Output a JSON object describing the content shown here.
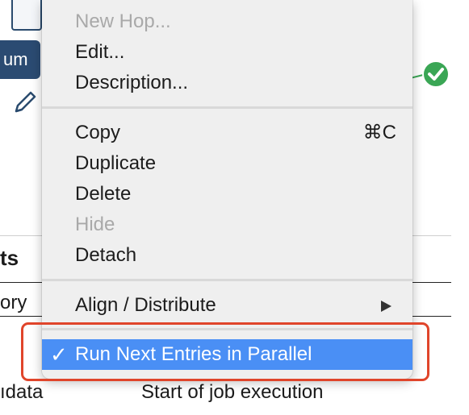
{
  "background": {
    "node_label": "um",
    "section_title": "ts",
    "table_cell_partial": "ory",
    "row_left": "ıdata",
    "row_right": "Start of job execution",
    "icons": [
      "document-icon",
      "pencil-icon",
      "success-check-icon"
    ]
  },
  "context_menu": {
    "items": [
      {
        "label": "New Hop...",
        "enabled": false
      },
      {
        "label": "Edit...",
        "enabled": true
      },
      {
        "label": "Description...",
        "enabled": true
      },
      {
        "label": "Copy",
        "shortcut": "⌘C",
        "enabled": true
      },
      {
        "label": "Duplicate",
        "enabled": true
      },
      {
        "label": "Delete",
        "enabled": true
      },
      {
        "label": "Hide",
        "enabled": false
      },
      {
        "label": "Detach",
        "enabled": true
      },
      {
        "label": "Align / Distribute",
        "enabled": true,
        "submenu": true
      },
      {
        "label": "Run Next Entries in Parallel",
        "checked": true,
        "highlighted": true,
        "enabled": true
      }
    ],
    "checkmark": "✓"
  },
  "colors": {
    "highlight": "#4a8ff5",
    "annotation": "#e0452b",
    "success": "#3aa655",
    "node": "#2b4b72"
  }
}
